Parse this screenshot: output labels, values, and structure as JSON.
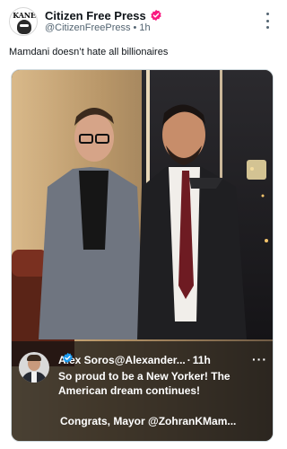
{
  "post": {
    "author_name": "Citizen Free Press",
    "handle": "@CitizenFreePress",
    "separator": "•",
    "time": "1h",
    "avatar_text": "KANE",
    "text": "Mamdani doesn’t hate all billionaires",
    "verified_color": "#f91880"
  },
  "embedded": {
    "author_name": "Alex Soros",
    "handle": "@Alexander...",
    "separator": "·",
    "time": "11h",
    "more": "···",
    "text": "So proud to be a New Yorker! The American dream continues!",
    "line3": "Congrats, Mayor @ZohranKMam...",
    "verified_color": "#1d9bf0"
  }
}
